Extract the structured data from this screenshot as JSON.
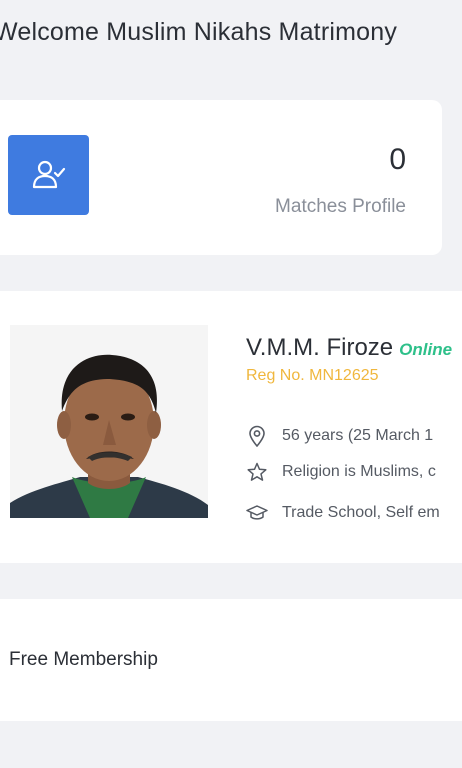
{
  "header": {
    "welcome": "Welcome Muslim Nikahs Matrimony"
  },
  "stats": {
    "count": "0",
    "label": "Matches Profile",
    "icon": "user-check-icon",
    "accent_color": "#3f7be0"
  },
  "profile": {
    "name": "V.M.M. Firoze",
    "status": "Online",
    "reg_no": "Reg No. MN12625",
    "age": "56 years (25 March 1",
    "religion": "Religion is Muslims, c",
    "education": "Trade School, Self em",
    "status_color": "#2ec08a",
    "reg_color": "#f0b73d"
  },
  "membership": {
    "label": "Free Membership"
  }
}
